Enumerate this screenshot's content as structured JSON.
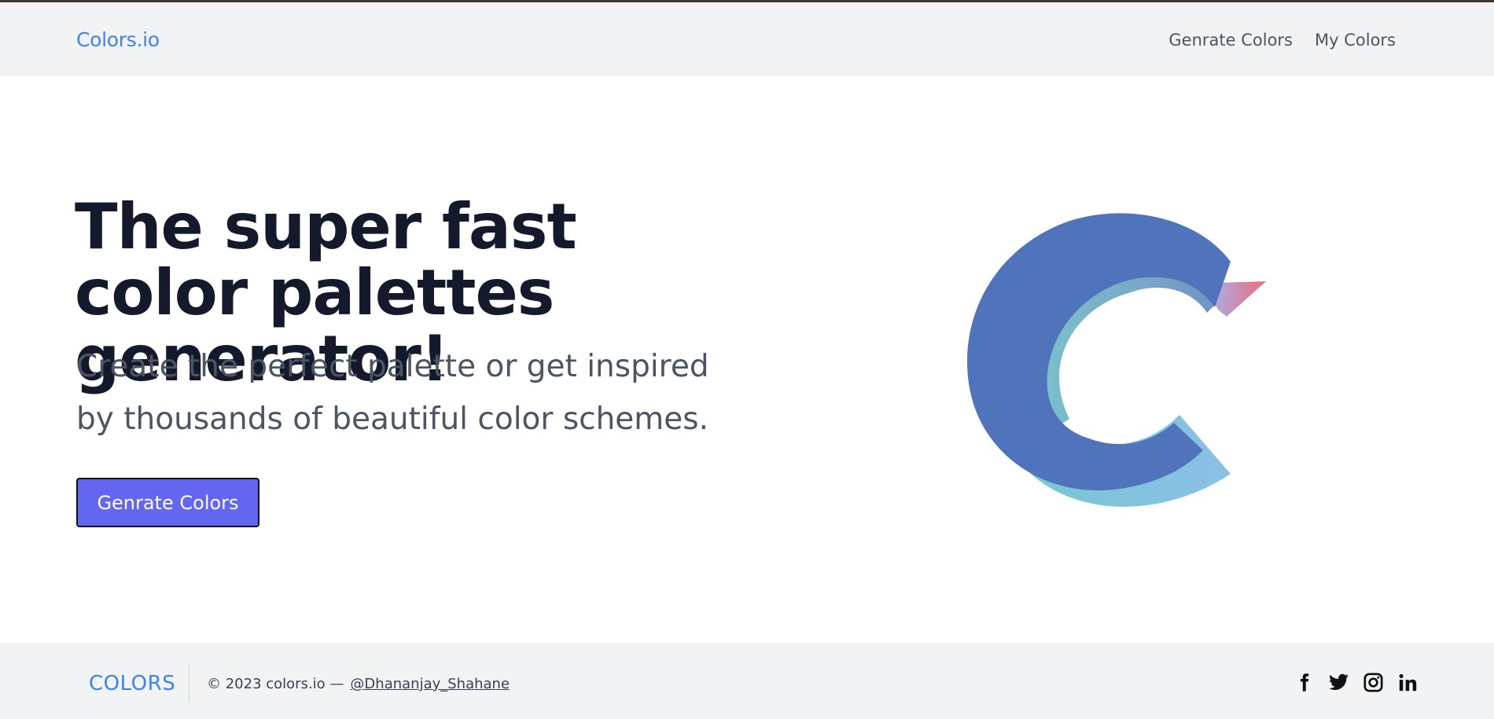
{
  "header": {
    "brand": "Colors.io",
    "nav": [
      "Genrate Colors",
      "My Colors"
    ]
  },
  "hero": {
    "title": "The super fast color palettes generator!",
    "subtitle": "Create the perfect palette or get inspired by thousands of beautiful color schemes.",
    "cta_label": "Genrate Colors"
  },
  "footer": {
    "brand": "COLORS",
    "copyright": "© 2023 colors.io —",
    "handle": "@Dhananjay_Shahane",
    "social_icons": [
      "facebook-icon",
      "twitter-icon",
      "instagram-icon",
      "linkedin-icon"
    ]
  },
  "colors": {
    "accent": "#3b82f6",
    "button": "#6366f1",
    "heading": "#141a2b",
    "logo_main": "#4f74bb",
    "logo_teal": "#79c3cc",
    "logo_pink": "#ef6b7a"
  }
}
